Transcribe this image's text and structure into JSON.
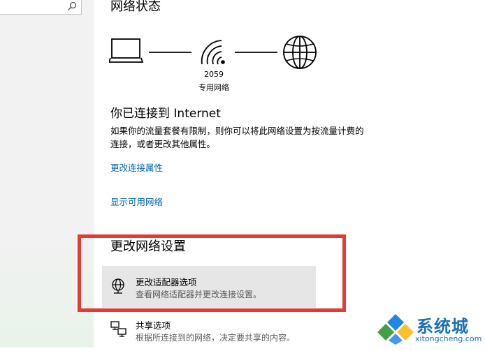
{
  "network_status": {
    "title": "网络状态",
    "network_name": "2059",
    "network_type": "专用网络"
  },
  "connection": {
    "title": "你已连接到 Internet",
    "desc_line1": "如果你的流量套餐有限制，则你可以将此网络设置为按流量计费的",
    "desc_line2": "连接，或者更改其他属性。",
    "link_properties": "更改连接属性",
    "link_available": "显示可用网络"
  },
  "change_settings": {
    "title": "更改网络设置",
    "items": [
      {
        "title": "更改适配器选项",
        "desc": "查看网络适配器并更改连接设置。",
        "icon": "adapter-globe-icon"
      },
      {
        "title": "共享选项",
        "desc": "根据所连接到的网络，决定要共享的内容。",
        "icon": "sharing-icon"
      }
    ]
  },
  "watermark": {
    "name": "系统城",
    "url": "xitongcheng.com"
  },
  "colors": {
    "link": "#0067b8",
    "highlight": "#e53935",
    "hover_bg": "#e6e6e6"
  }
}
